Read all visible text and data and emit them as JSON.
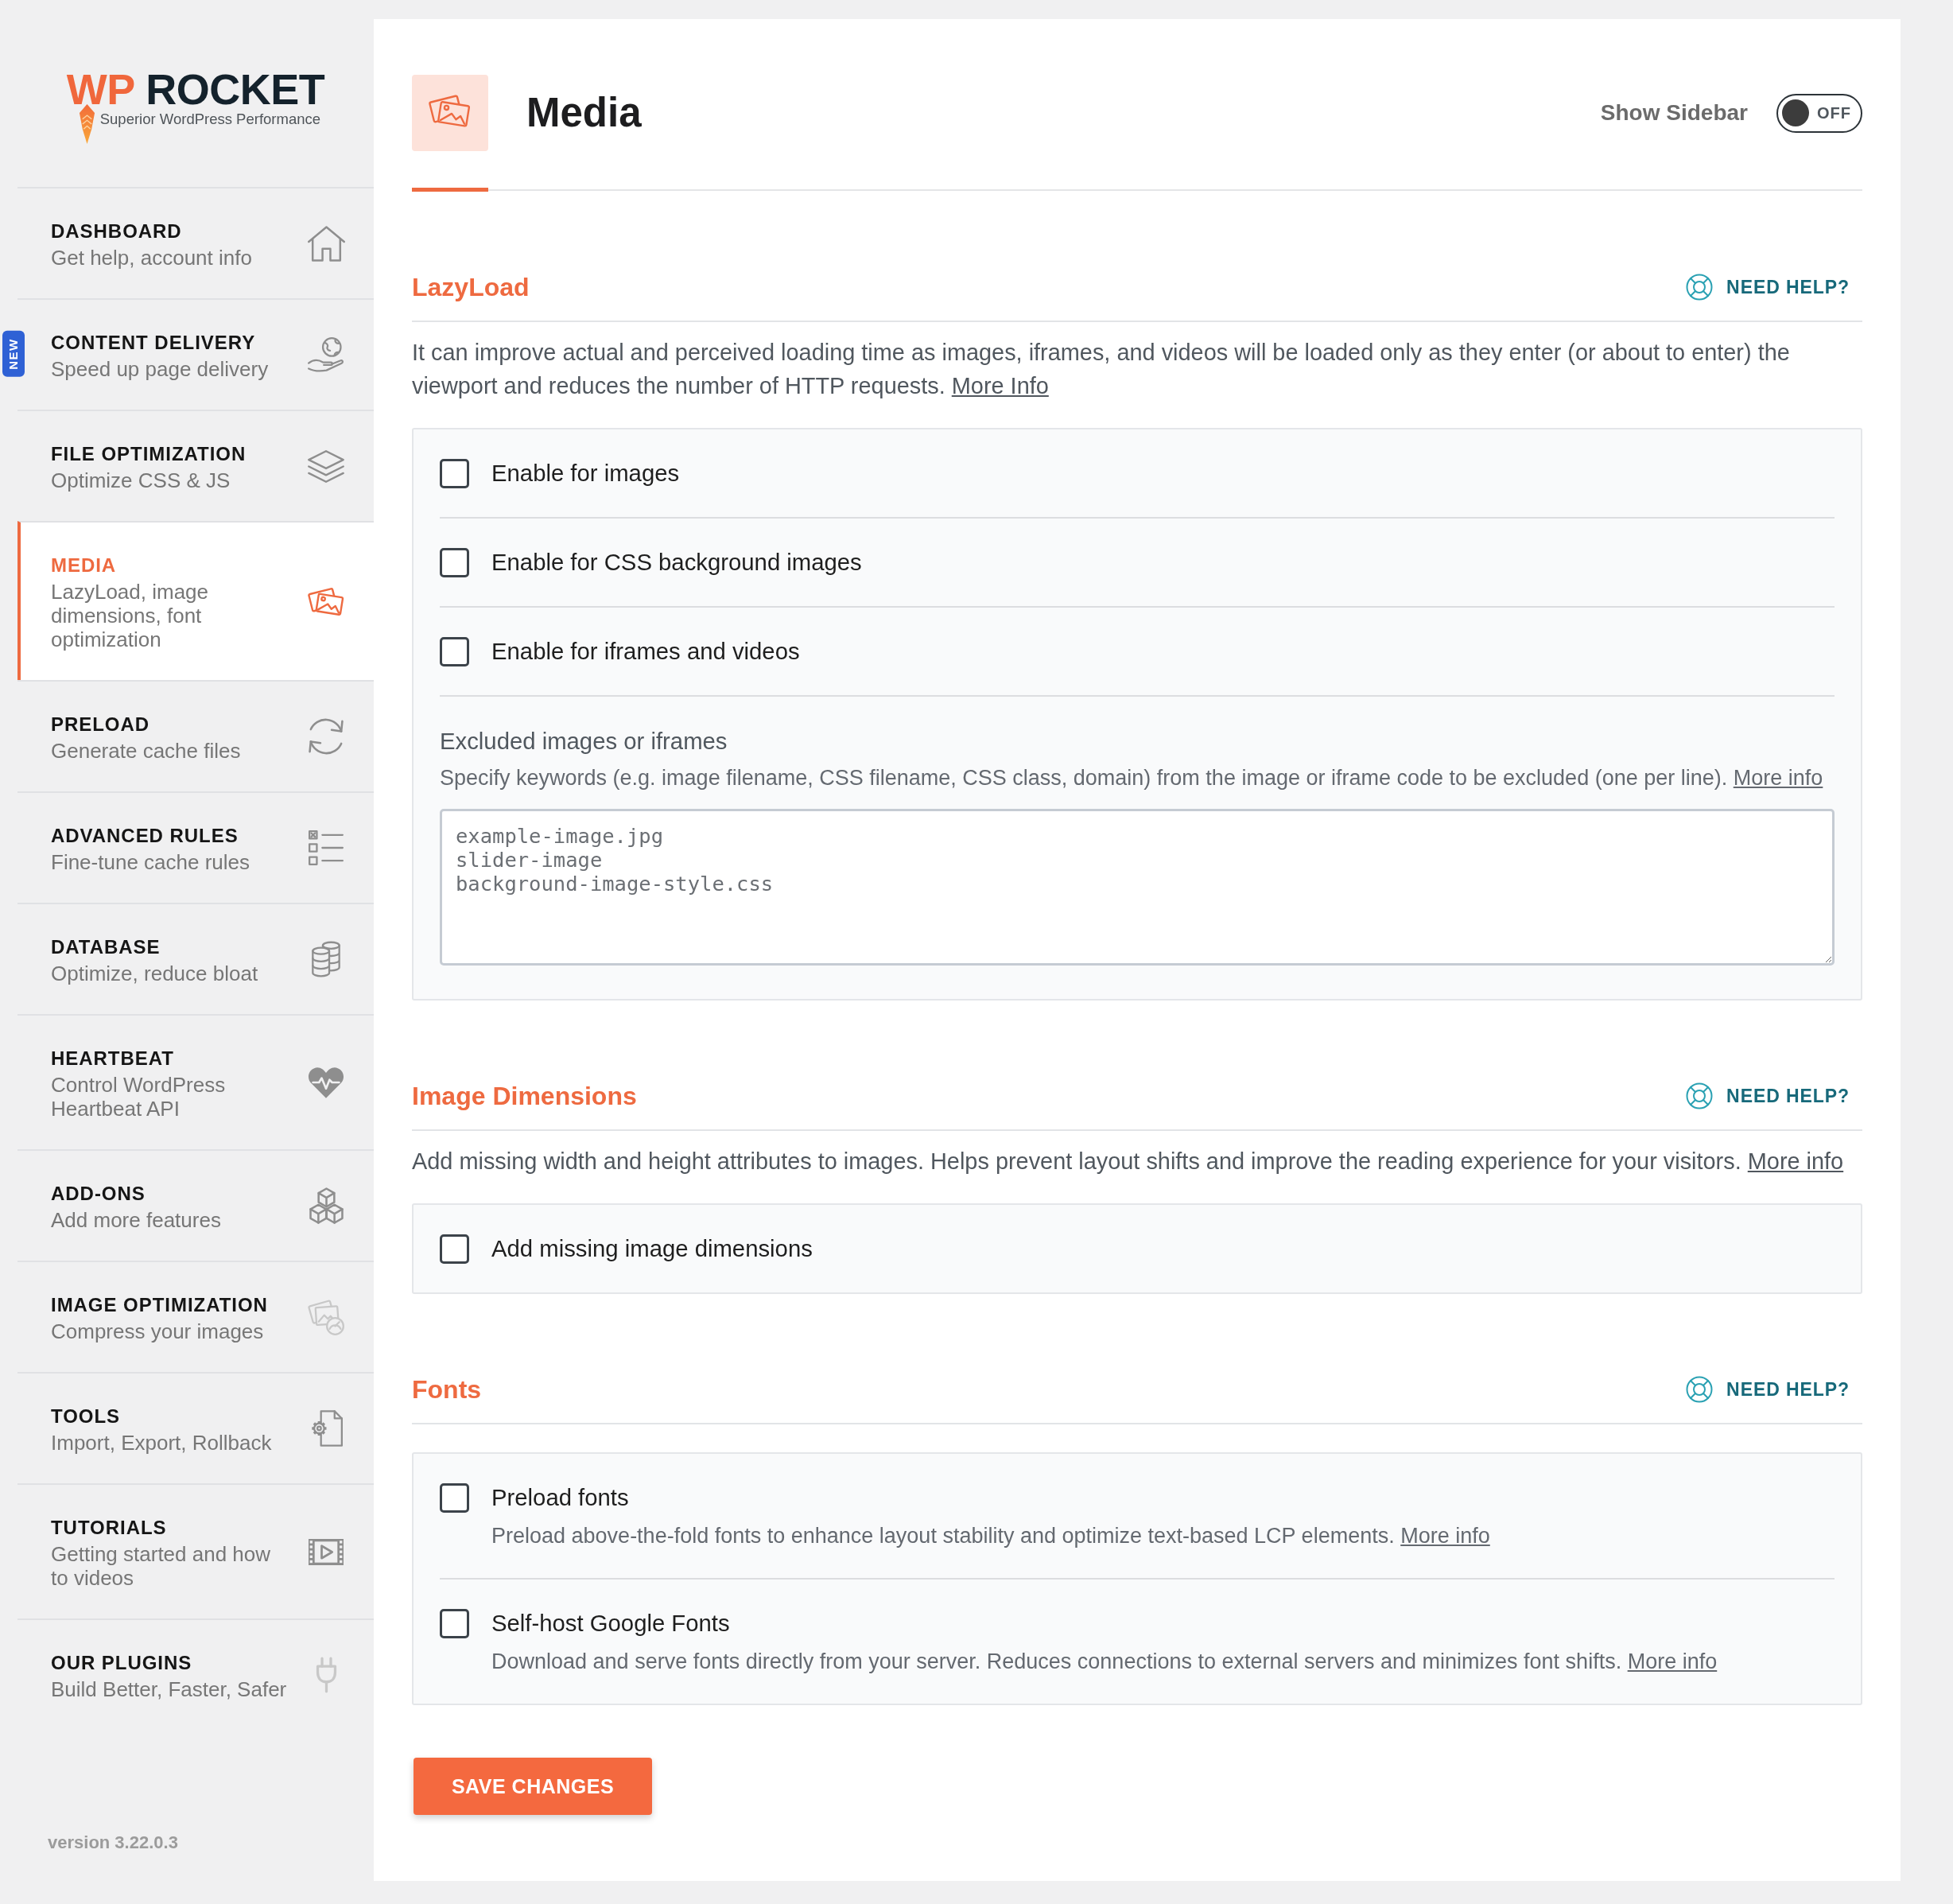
{
  "logo": {
    "accent": "WP",
    "name": "ROCKET",
    "tagline": "Superior WordPress Performance"
  },
  "sidebar": {
    "items": [
      {
        "title": "DASHBOARD",
        "subtitle": "Get help, account info",
        "selected": false
      },
      {
        "title": "CONTENT DELIVERY",
        "subtitle": "Speed up page delivery",
        "selected": false,
        "badge": "NEW"
      },
      {
        "title": "FILE OPTIMIZATION",
        "subtitle": "Optimize CSS & JS",
        "selected": false
      },
      {
        "title": "MEDIA",
        "subtitle": "LazyLoad, image dimensions, font optimization",
        "selected": true
      },
      {
        "title": "PRELOAD",
        "subtitle": "Generate cache files",
        "selected": false
      },
      {
        "title": "ADVANCED RULES",
        "subtitle": "Fine-tune cache rules",
        "selected": false
      },
      {
        "title": "DATABASE",
        "subtitle": "Optimize, reduce bloat",
        "selected": false
      },
      {
        "title": "HEARTBEAT",
        "subtitle": "Control WordPress Heartbeat API",
        "selected": false
      },
      {
        "title": "ADD-ONS",
        "subtitle": "Add more features",
        "selected": false
      },
      {
        "title": "IMAGE OPTIMIZATION",
        "subtitle": "Compress your images",
        "selected": false
      },
      {
        "title": "TOOLS",
        "subtitle": "Import, Export, Rollback",
        "selected": false
      },
      {
        "title": "TUTORIALS",
        "subtitle": "Getting started and how to videos",
        "selected": false
      },
      {
        "title": "OUR PLUGINS",
        "subtitle": "Build Better, Faster, Safer",
        "selected": false
      }
    ],
    "version": "version 3.22.0.3"
  },
  "header": {
    "title": "Media",
    "show_sidebar": {
      "label": "Show Sidebar",
      "on": false,
      "state_text": "OFF"
    }
  },
  "sections": [
    {
      "title": "LazyLoad",
      "help": "NEED HELP?",
      "description": "It can improve actual and perceived loading time as images, iframes, and videos will be loaded only as they enter (or about to enter) the viewport and reduces the number of HTTP requests.",
      "link": "More Info",
      "options": [
        {
          "kind": "checkbox",
          "label": "Enable for images",
          "checked": false
        },
        {
          "kind": "checkbox",
          "label": "Enable for CSS background images",
          "checked": false
        },
        {
          "kind": "checkbox",
          "label": "Enable for iframes and videos",
          "checked": false
        },
        {
          "kind": "textarea",
          "label": "Excluded images or iframes",
          "description": "Specify keywords (e.g. image filename, CSS filename, CSS class, domain) from the image or iframe code to be excluded (one per line).",
          "link": "More info",
          "placeholder": "example-image.jpg\nslider-image\nbackground-image-style.css"
        }
      ]
    },
    {
      "title": "Image Dimensions",
      "help": "NEED HELP?",
      "description": "Add missing width and height attributes to images. Helps prevent layout shifts and improve the reading experience for your visitors.",
      "link": "More info",
      "options": [
        {
          "kind": "checkbox",
          "label": "Add missing image dimensions",
          "checked": false
        }
      ]
    },
    {
      "title": "Fonts",
      "help": "NEED HELP?",
      "options": [
        {
          "kind": "checkbox",
          "label": "Preload fonts",
          "checked": false,
          "description": "Preload above-the-fold fonts to enhance layout stability and optimize text-based LCP elements.",
          "link": "More info"
        },
        {
          "kind": "checkbox",
          "label": "Self-host Google Fonts",
          "checked": false,
          "description": "Download and serve fonts directly from your server. Reduces connections to external servers and minimizes font shifts.",
          "link": "More info"
        }
      ]
    }
  ],
  "save_button": "SAVE CHANGES"
}
